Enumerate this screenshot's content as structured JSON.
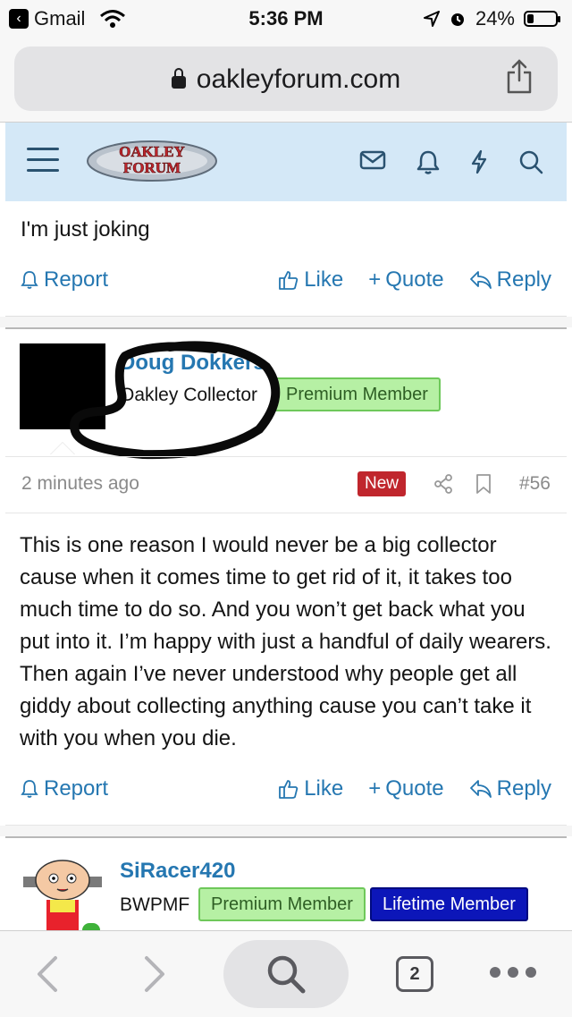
{
  "status_bar": {
    "back_app": "Gmail",
    "time": "5:36 PM",
    "battery": "24%",
    "battery_level": 0.24
  },
  "browser": {
    "url": "oakleyforum.com",
    "tab_count": "2"
  },
  "forum_header": {
    "logo_line1": "OAKLEY",
    "logo_line2": "FORUM",
    "icons": [
      "menu-icon",
      "envelope-icon",
      "bell-icon",
      "bolt-icon",
      "search-icon"
    ]
  },
  "prev_post": {
    "text": "I'm just joking"
  },
  "actions": {
    "report": "Report",
    "like": "Like",
    "quote": "Quote",
    "reply": "Reply"
  },
  "post56": {
    "username": "Doug Dokkers",
    "user_title": "Oakley Collector",
    "badge": "Premium Member",
    "time_ago": "2 minutes ago",
    "new_label": "New",
    "post_number": "#56",
    "body": "This is one reason I would never be a big collector cause when it comes time to get rid of it, it takes too much time to do so. And you won’t get back what you put into it. I’m happy with just a handful of daily wearers. Then again I’ve never understood why people get all giddy about collecting anything cause you can’t take it with you when you die."
  },
  "next_post": {
    "username": "SiRacer420",
    "user_title": "BWPMF",
    "badge1": "Premium Member",
    "badge2": "Lifetime Member"
  },
  "colors": {
    "link": "#2577b1",
    "header_bg": "#d4e8f7",
    "premium_bg": "#b6f0a4",
    "lifetime_bg": "#0c16b9",
    "new_badge": "#c0262d"
  }
}
